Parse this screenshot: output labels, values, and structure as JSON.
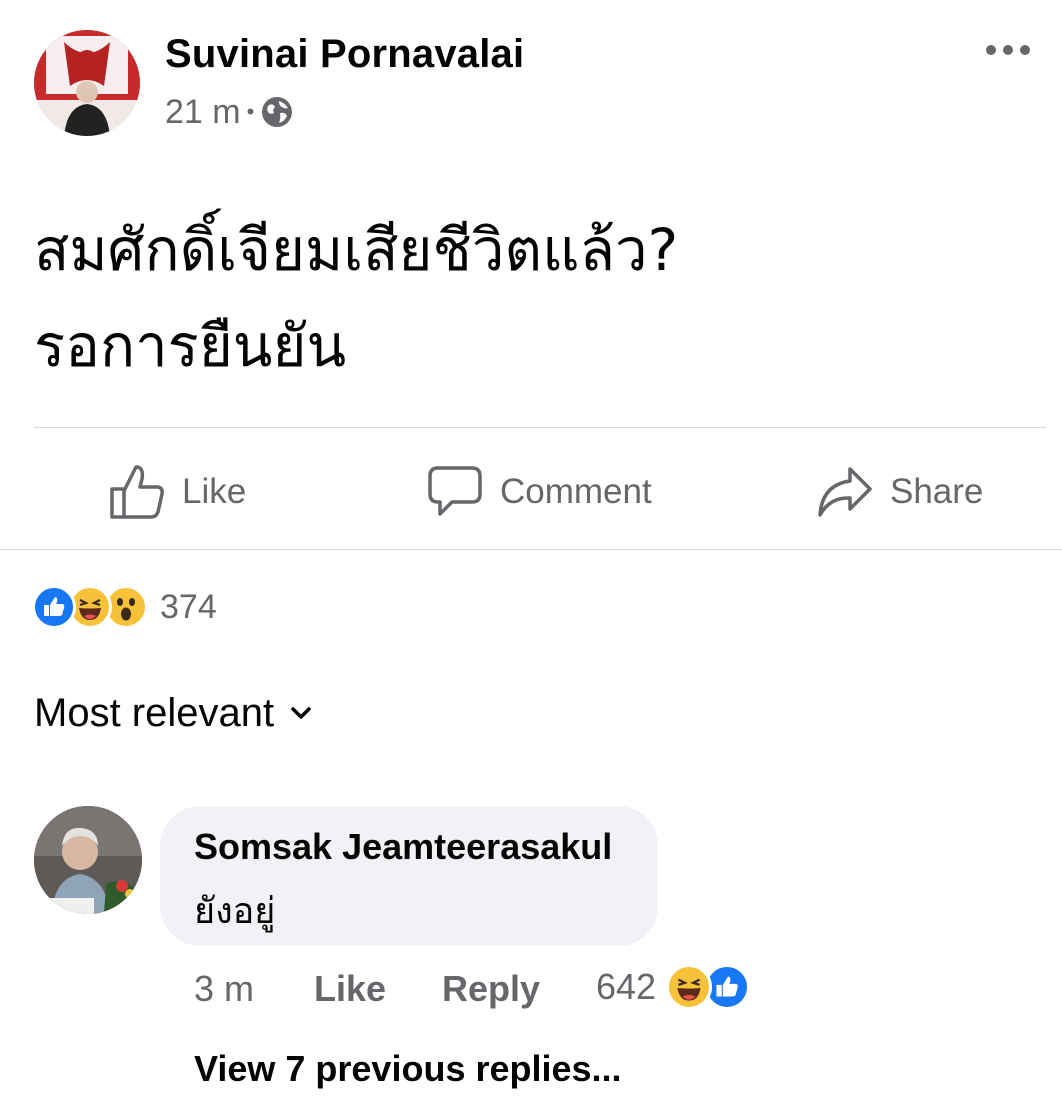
{
  "post": {
    "author": "Suvinai Pornavalai",
    "time": "21 m",
    "separator": "•",
    "privacy_icon": "globe-icon",
    "text_line1": "สมศักดิ์เจียมเสียชีวิตแล้ว?",
    "text_line2": "รอการยืนยัน"
  },
  "actions": {
    "like": "Like",
    "comment": "Comment",
    "share": "Share"
  },
  "reactions": {
    "icons": [
      "like-icon",
      "haha-icon",
      "wow-icon"
    ],
    "count": "374"
  },
  "sort": {
    "label": "Most relevant"
  },
  "comment": {
    "author": "Somsak Jeamteerasakul",
    "text": "ยังอยู่",
    "time": "3 m",
    "like": "Like",
    "reply": "Reply",
    "reaction_count": "642",
    "reaction_icons": [
      "haha-icon",
      "like-icon"
    ]
  },
  "view_replies": "View 7 previous replies...",
  "colors": {
    "text": "#050505",
    "secondary": "#65676b",
    "bubble": "#f0f2f5",
    "like_blue": "#1877f2",
    "reaction_yellow": "#f7c23a"
  }
}
